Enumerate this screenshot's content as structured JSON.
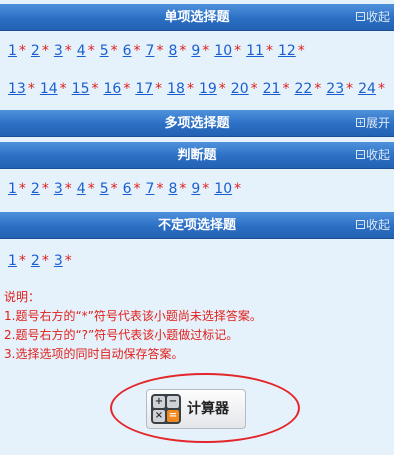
{
  "sections": {
    "single": {
      "title": "单项选择题",
      "toggle": "收起",
      "rows": [
        [
          "1",
          "2",
          "3",
          "4",
          "5",
          "6",
          "7",
          "8",
          "9",
          "10",
          "11",
          "12"
        ],
        [
          "13",
          "14",
          "15",
          "16",
          "17",
          "18",
          "19",
          "20",
          "21",
          "22",
          "23",
          "24"
        ]
      ]
    },
    "multi": {
      "title": "多项选择题",
      "toggle": "展开"
    },
    "judge": {
      "title": "判断题",
      "toggle": "收起",
      "rows": [
        [
          "1",
          "2",
          "3",
          "4",
          "5",
          "6",
          "7",
          "8",
          "9",
          "10"
        ]
      ]
    },
    "indef": {
      "title": "不定项选择题",
      "toggle": "收起",
      "rows": [
        [
          "1",
          "2",
          "3"
        ]
      ]
    }
  },
  "star": "*",
  "notes": {
    "heading": "说明：",
    "line1": "1.题号右方的“*”符号代表该小题尚未选择答案。",
    "line2": "2.题号右方的“?”符号代表该小题做过标记。",
    "line3": "3.选择选项的同时自动保存答案。"
  },
  "calculator": {
    "label": "计算器"
  },
  "colors": {
    "header": "#2b6fc4",
    "link": "#1a5fd1",
    "star": "#e02020",
    "notes": "#e0201c",
    "oval": "#e3262a"
  }
}
